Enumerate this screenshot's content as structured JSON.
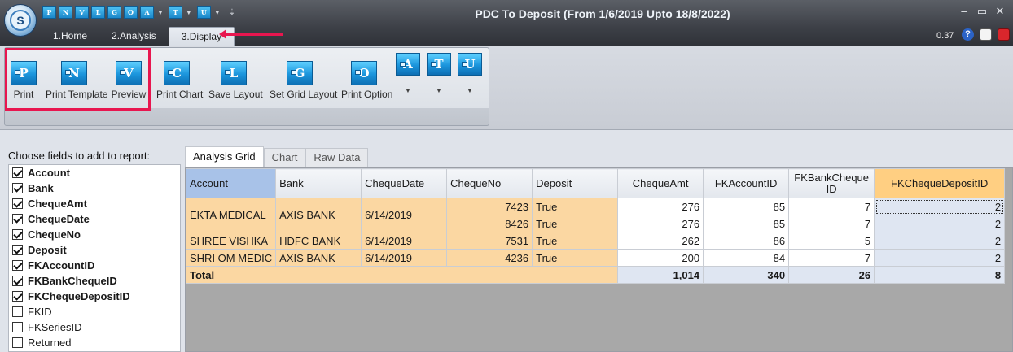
{
  "window": {
    "title": "PDC To Deposit (From 1/6/2019 Upto 18/8/2022)",
    "minimize": "–",
    "maximize": "▭",
    "close": "✕",
    "status_value": "0.37"
  },
  "app_logo_glyph": "S",
  "quick_access": [
    {
      "letter": "P",
      "dropdown": false
    },
    {
      "letter": "N",
      "dropdown": false
    },
    {
      "letter": "V",
      "dropdown": false
    },
    {
      "letter": "L",
      "dropdown": false
    },
    {
      "letter": "G",
      "dropdown": false
    },
    {
      "letter": "O",
      "dropdown": false
    },
    {
      "letter": "A",
      "dropdown": true
    },
    {
      "letter": "T",
      "dropdown": true
    },
    {
      "letter": "U",
      "dropdown": true
    }
  ],
  "ribbon_tabs": [
    {
      "label": "1.Home"
    },
    {
      "label": "2.Analysis"
    },
    {
      "label": "3.Display"
    }
  ],
  "ribbon": {
    "print": {
      "icon": "P",
      "label": "Print"
    },
    "print_template": {
      "icon": "N",
      "label": "Print Template"
    },
    "preview": {
      "icon": "V",
      "label": "Preview"
    },
    "print_chart": {
      "icon": "C",
      "label": "Print Chart"
    },
    "save_layout": {
      "icon": "L",
      "label": "Save Layout"
    },
    "set_grid_layout": {
      "icon": "G",
      "label": "Set Grid Layout"
    },
    "print_option": {
      "icon": "O",
      "label": "Print Option"
    },
    "a_menu": {
      "icon": "A"
    },
    "t_menu": {
      "icon": "T"
    },
    "u_menu": {
      "icon": "U"
    }
  },
  "fields_panel": {
    "caption": "Choose fields to add to report:",
    "fields": [
      {
        "label": "Account",
        "checked": true
      },
      {
        "label": "Bank",
        "checked": true
      },
      {
        "label": "ChequeAmt",
        "checked": true
      },
      {
        "label": "ChequeDate",
        "checked": true
      },
      {
        "label": "ChequeNo",
        "checked": true
      },
      {
        "label": "Deposit",
        "checked": true
      },
      {
        "label": "FKAccountID",
        "checked": true
      },
      {
        "label": "FKBankChequeID",
        "checked": true
      },
      {
        "label": "FKChequeDepositID",
        "checked": true
      },
      {
        "label": "FKID",
        "checked": false
      },
      {
        "label": "FKSeriesID",
        "checked": false
      },
      {
        "label": "Returned",
        "checked": false
      }
    ]
  },
  "grid_tabs": [
    {
      "label": "Analysis Grid"
    },
    {
      "label": "Chart"
    },
    {
      "label": "Raw Data"
    }
  ],
  "grid": {
    "columns": [
      "Account",
      "Bank",
      "ChequeDate",
      "ChequeNo",
      "Deposit",
      "ChequeAmt",
      "FKAccountID",
      "FKBankCheque ID",
      "FKChequeDepositID"
    ],
    "groups": [
      {
        "account": "EKTA MEDICAL",
        "bank": "AXIS BANK",
        "date": "6/14/2019",
        "rows": [
          {
            "cheque_no": "7423",
            "deposit": "True",
            "amt": "276",
            "account_id": "85",
            "bank_cheque_id": "7",
            "deposit_id": "2"
          },
          {
            "cheque_no": "8426",
            "deposit": "True",
            "amt": "276",
            "account_id": "85",
            "bank_cheque_id": "7",
            "deposit_id": "2"
          }
        ]
      },
      {
        "account": "SHREE VISHKA",
        "bank": "HDFC BANK",
        "date": "6/14/2019",
        "rows": [
          {
            "cheque_no": "7531",
            "deposit": "True",
            "amt": "262",
            "account_id": "86",
            "bank_cheque_id": "5",
            "deposit_id": "2"
          }
        ]
      },
      {
        "account": "SHRI OM MEDIC",
        "bank": "AXIS BANK",
        "date": "6/14/2019",
        "rows": [
          {
            "cheque_no": "4236",
            "deposit": "True",
            "amt": "200",
            "account_id": "84",
            "bank_cheque_id": "7",
            "deposit_id": "2"
          }
        ]
      }
    ],
    "total": {
      "label": "Total",
      "amt": "1,014",
      "account_id": "340",
      "bank_cheque_id": "26",
      "deposit_id": "8"
    }
  }
}
